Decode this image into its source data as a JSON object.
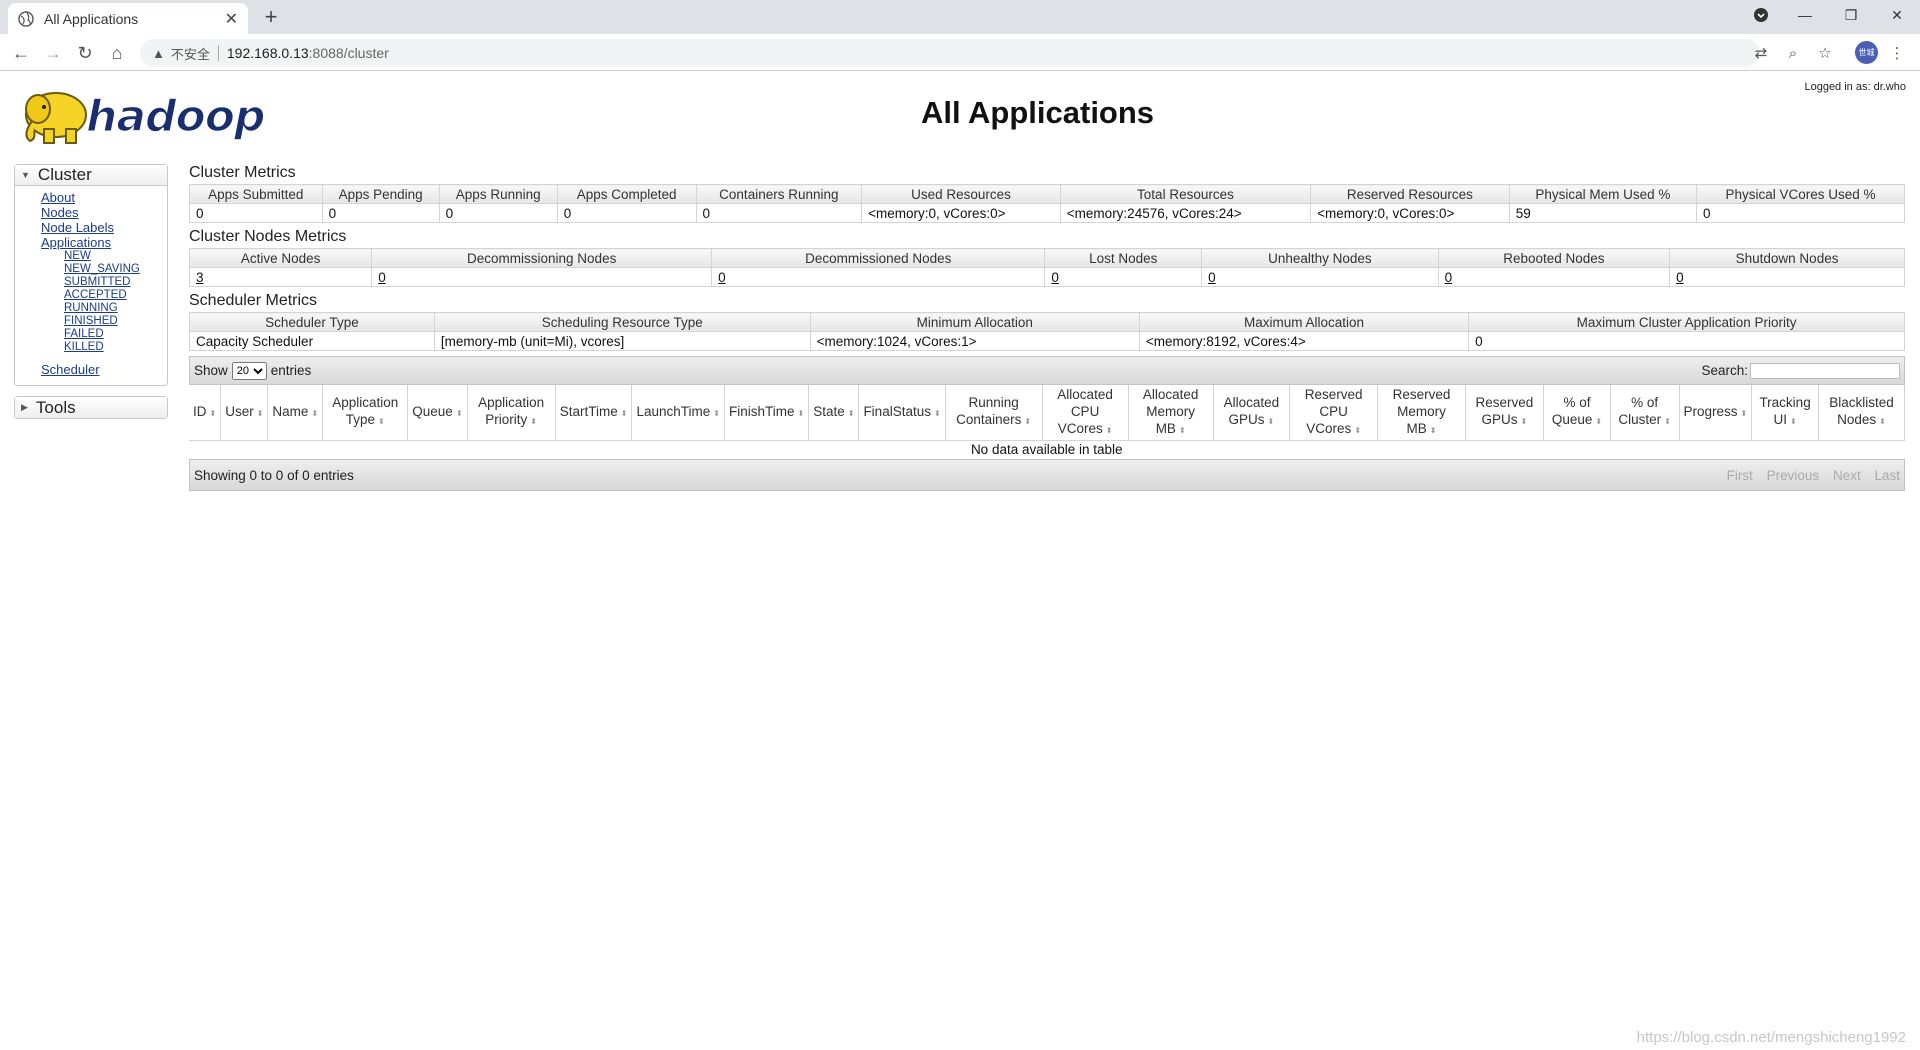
{
  "browser": {
    "tab_title": "All Applications",
    "new_tab": "+",
    "insecure_label": "不安全",
    "url_host": "192.168.0.13",
    "url_path": ":8088/cluster",
    "profile_text": "世城"
  },
  "header": {
    "title": "All Applications",
    "logged_in": "Logged in as: dr.who"
  },
  "nav": {
    "cluster_label": "Cluster",
    "cluster_links": [
      "About",
      "Nodes",
      "Node Labels",
      "Applications"
    ],
    "app_states": [
      "NEW",
      "NEW_SAVING",
      "SUBMITTED",
      "ACCEPTED",
      "RUNNING",
      "FINISHED",
      "FAILED",
      "KILLED"
    ],
    "scheduler": "Scheduler",
    "tools_label": "Tools"
  },
  "cluster_metrics": {
    "title": "Cluster Metrics",
    "headers": [
      "Apps Submitted",
      "Apps Pending",
      "Apps Running",
      "Apps Completed",
      "Containers Running",
      "Used Resources",
      "Total Resources",
      "Reserved Resources",
      "Physical Mem Used %",
      "Physical VCores Used %"
    ],
    "values": [
      "0",
      "0",
      "0",
      "0",
      "0",
      "<memory:0, vCores:0>",
      "<memory:24576, vCores:24>",
      "<memory:0, vCores:0>",
      "59",
      "0"
    ]
  },
  "node_metrics": {
    "title": "Cluster Nodes Metrics",
    "headers": [
      "Active Nodes",
      "Decommissioning Nodes",
      "Decommissioned Nodes",
      "Lost Nodes",
      "Unhealthy Nodes",
      "Rebooted Nodes",
      "Shutdown Nodes"
    ],
    "values": [
      "3",
      "0",
      "0",
      "0",
      "0",
      "0",
      "0"
    ]
  },
  "scheduler_metrics": {
    "title": "Scheduler Metrics",
    "headers": [
      "Scheduler Type",
      "Scheduling Resource Type",
      "Minimum Allocation",
      "Maximum Allocation",
      "Maximum Cluster Application Priority"
    ],
    "values": [
      "Capacity Scheduler",
      "[memory-mb (unit=Mi), vcores]",
      "<memory:1024, vCores:1>",
      "<memory:8192, vCores:4>",
      "0"
    ]
  },
  "apps_table": {
    "show_label": "Show",
    "entries_value": "20",
    "entries_label": "entries",
    "search_label": "Search:",
    "columns": [
      "ID",
      "User",
      "Name",
      "Application Type",
      "Queue",
      "Application Priority",
      "StartTime",
      "LaunchTime",
      "FinishTime",
      "State",
      "FinalStatus",
      "Running Containers",
      "Allocated CPU VCores",
      "Allocated Memory MB",
      "Allocated GPUs",
      "Reserved CPU VCores",
      "Reserved Memory MB",
      "Reserved GPUs",
      "% of Queue",
      "% of Cluster",
      "Progress",
      "Tracking UI",
      "Blacklisted Nodes"
    ],
    "empty_text": "No data available in table",
    "showing_text": "Showing 0 to 0 of 0 entries",
    "pager": [
      "First",
      "Previous",
      "Next",
      "Last"
    ]
  },
  "watermark": "https://blog.csdn.net/mengshicheng1992"
}
